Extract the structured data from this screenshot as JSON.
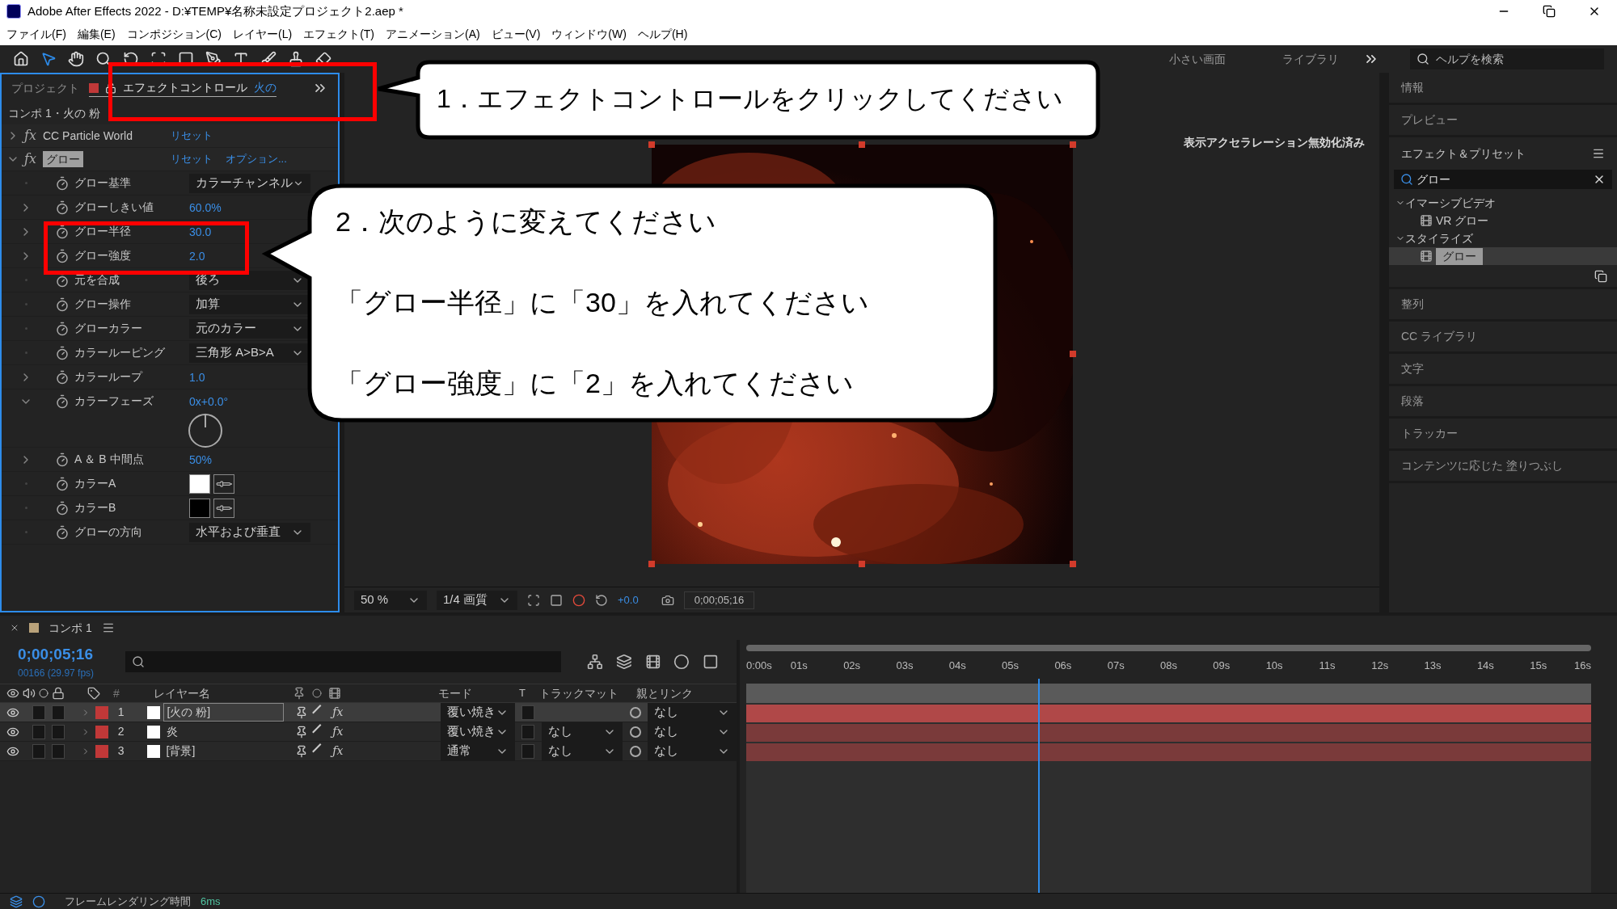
{
  "window": {
    "title": "Adobe After Effects 2022 - D:¥TEMP¥名称未設定プロジェクト2.aep *"
  },
  "menu": [
    "ファイル(F)",
    "編集(E)",
    "コンポジション(C)",
    "レイヤー(L)",
    "エフェクト(T)",
    "アニメーション(A)",
    "ビュー(V)",
    "ウィンドウ(W)",
    "ヘルプ(H)"
  ],
  "workspaces": [
    {
      "label": "小さい画面"
    },
    {
      "label": "ライブラリ"
    }
  ],
  "help_search": {
    "placeholder": "ヘルプを検索"
  },
  "effect_controls": {
    "tabs": [
      {
        "label": "プロジェクト",
        "selected": false
      },
      {
        "label": "エフェクトコントロール",
        "layer": "火の",
        "selected": true
      }
    ],
    "breadcrumb": "コンポ 1・火の 粉",
    "effects": [
      {
        "fx_symbol": "ƒx",
        "name": "CC Particle World",
        "expanded": false,
        "selected": false,
        "reset": "リセット"
      },
      {
        "fx_symbol": "ƒx",
        "name": "グロー",
        "expanded": true,
        "selected": true,
        "reset": "リセット",
        "options": "オプション...",
        "properties": [
          {
            "kind": "dropdown",
            "name": "グロー基準",
            "value": "カラーチャンネル",
            "expandable": false
          },
          {
            "kind": "number",
            "name": "グローしきい値",
            "value": "60.0%",
            "expandable": true,
            "expanded": false
          },
          {
            "kind": "number",
            "name": "グロー半径",
            "value": "30.0",
            "expandable": true,
            "expanded": false
          },
          {
            "kind": "number",
            "name": "グロー強度",
            "value": "2.0",
            "expandable": true,
            "expanded": false
          },
          {
            "kind": "dropdown",
            "name": "元を合成",
            "value": "後ろ",
            "expandable": false
          },
          {
            "kind": "dropdown",
            "name": "グロー操作",
            "value": "加算",
            "expandable": false
          },
          {
            "kind": "dropdown",
            "name": "グローカラー",
            "value": "元のカラー",
            "expandable": false
          },
          {
            "kind": "dropdown",
            "name": "カラールーピング",
            "value": "三角形 A>B>A",
            "expandable": false
          },
          {
            "kind": "number",
            "name": "カラーループ",
            "value": "1.0",
            "expandable": true,
            "expanded": false
          },
          {
            "kind": "angle",
            "name": "カラーフェーズ",
            "value": "0x+0.0°",
            "expandable": true,
            "expanded": true
          },
          {
            "kind": "number",
            "name": "A ＆ B 中間点",
            "value": "50%",
            "expandable": true,
            "expanded": false
          },
          {
            "kind": "color",
            "name": "カラーA",
            "color": "#ffffff",
            "expandable": false
          },
          {
            "kind": "color",
            "name": "カラーB",
            "color": "#000000",
            "expandable": false
          },
          {
            "kind": "dropdown",
            "name": "グローの方向",
            "value": "水平および垂直",
            "expandable": false
          }
        ]
      }
    ]
  },
  "viewer": {
    "status": "表示アクセラレーション無効化済み",
    "zoom": "50 %",
    "resolution": "1/4 画質",
    "exposure": "+0.0",
    "timecode": "0;00;05;16"
  },
  "right_panel": {
    "panels_top": [
      "情報",
      "プレビュー"
    ],
    "effects_presets": {
      "title": "エフェクト＆プリセット",
      "search": "グロー",
      "tree": [
        {
          "label": "イマーシブビデオ",
          "expanded": true,
          "children": [
            {
              "label": "VR グロー",
              "selected": false
            }
          ]
        },
        {
          "label": "スタイライズ",
          "expanded": true,
          "children": [
            {
              "label": "グロー",
              "selected": true
            }
          ]
        }
      ]
    },
    "panels_bottom": [
      "整列",
      "CC ライブラリ",
      "文字",
      "段落",
      "トラッカー",
      "コンテンツに応じた 塗りつぶし"
    ]
  },
  "timeline": {
    "tab": "コンポ 1",
    "timecode": "0;00;05;16",
    "frame_info": "00166 (29.97 fps)",
    "columns": {
      "number": "#",
      "name": "レイヤー名",
      "mode": "モード",
      "t": "T",
      "track_matte": "トラックマット",
      "parent": "親とリンク"
    },
    "ruler": [
      "0:00s",
      "01s",
      "02s",
      "03s",
      "04s",
      "05s",
      "06s",
      "07s",
      "08s",
      "09s",
      "10s",
      "11s",
      "12s",
      "13s",
      "14s",
      "15s",
      "16s"
    ],
    "playhead": {
      "level": 0.345
    },
    "layers": [
      {
        "number": "1",
        "name": "[火の 粉]",
        "fx_switch": "ƒx",
        "visible": true,
        "selected": true,
        "mode": "覆い焼き",
        "parent": "なし"
      },
      {
        "number": "2",
        "name": "炎",
        "fx_switch": "ƒx",
        "visible": true,
        "selected": false,
        "mode": "覆い焼き",
        "track_matte": "なし",
        "parent": "なし"
      },
      {
        "number": "3",
        "name": "[背景]",
        "fx_switch": "ƒx",
        "visible": true,
        "selected": false,
        "mode": "通常",
        "track_matte": "なし",
        "parent": "なし"
      }
    ]
  },
  "status_bar": {
    "label": "フレームレンダリング時間",
    "value": "6ms"
  },
  "callouts": [
    {
      "lines": [
        "1．エフェクトコントロールをクリックしてください"
      ]
    },
    {
      "lines": [
        "2．次のように変えてください",
        "「グロー半径」に「30」を入れてください",
        "「グロー強度」に「2」を入れてください"
      ]
    }
  ]
}
